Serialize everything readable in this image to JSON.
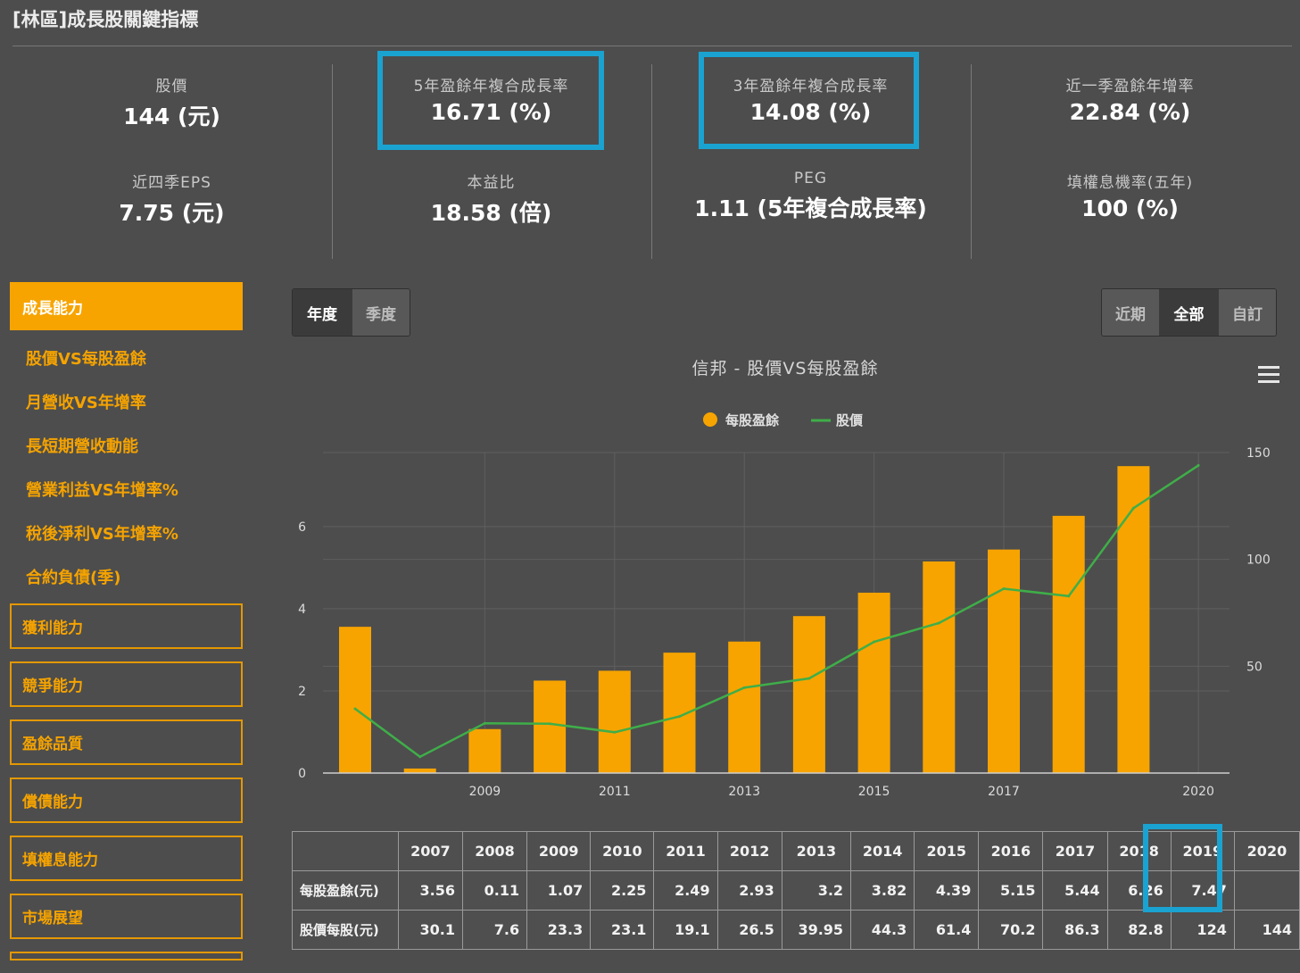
{
  "page_title": "[林區]成長股關鍵指標",
  "kpis": [
    {
      "label": "股價",
      "value": "144 (元)"
    },
    {
      "label": "近四季EPS",
      "value": "7.75 (元)"
    },
    {
      "label": "5年盈餘年複合成長率",
      "value": "16.71 (%)"
    },
    {
      "label": "本益比",
      "value": "18.58 (倍)"
    },
    {
      "label": "3年盈餘年複合成長率",
      "value": "14.08 (%)"
    },
    {
      "label": "PEG",
      "value": "1.11 (5年複合成長率)"
    },
    {
      "label": "近一季盈餘年增率",
      "value": "22.84 (%)"
    },
    {
      "label": "填權息機率(五年)",
      "value": "100 (%)"
    }
  ],
  "sidebar": {
    "active": "成長能力",
    "sub_items": [
      "股價VS每股盈餘",
      "月營收VS年增率",
      "長短期營收動能",
      "營業利益VS年增率%",
      "稅後淨利VS年增率%",
      "合約負債(季)"
    ],
    "sections": [
      "獲利能力",
      "競爭能力",
      "盈餘品質",
      "償債能力",
      "填權息能力",
      "市場展望"
    ]
  },
  "period_toggle": {
    "options": [
      "年度",
      "季度"
    ],
    "selected": "年度"
  },
  "range_toggle": {
    "options": [
      "近期",
      "全部",
      "自訂"
    ],
    "selected": "全部"
  },
  "chart_title": "信邦 - 股價VS每股盈餘",
  "colors": {
    "eps_bar": "#f7a400",
    "price_line": "#3fae49",
    "highlight": "#1aa3d1",
    "accent": "#f7a400"
  },
  "chart_data": {
    "type": "bar",
    "title": "信邦 - 股價VS每股盈餘",
    "categories": [
      "2007",
      "2008",
      "2009",
      "2010",
      "2011",
      "2012",
      "2013",
      "2014",
      "2015",
      "2016",
      "2017",
      "2018",
      "2019",
      "2020"
    ],
    "x_tick_labels": [
      "2009",
      "2011",
      "2013",
      "2015",
      "2017",
      "2020"
    ],
    "series": [
      {
        "name": "每股盈餘",
        "type": "bar",
        "axis": "left",
        "values": [
          3.56,
          0.11,
          1.07,
          2.25,
          2.49,
          2.93,
          3.2,
          3.82,
          4.39,
          5.15,
          5.44,
          6.26,
          7.47,
          null
        ]
      },
      {
        "name": "股價",
        "type": "line",
        "axis": "right",
        "values": [
          30.1,
          7.6,
          23.3,
          23.1,
          19.1,
          26.5,
          39.95,
          44.3,
          61.4,
          70.2,
          86.3,
          82.8,
          124,
          144
        ]
      }
    ],
    "y_left": {
      "range": [
        0,
        7.8
      ],
      "ticks": [
        0,
        2,
        4,
        6
      ]
    },
    "y_right": {
      "range": [
        0,
        150
      ],
      "ticks": [
        50,
        100,
        150
      ]
    },
    "grid": true,
    "legend_position": "top-center"
  },
  "table": {
    "years": [
      "2007",
      "2008",
      "2009",
      "2010",
      "2011",
      "2012",
      "2013",
      "2014",
      "2015",
      "2016",
      "2017",
      "2018",
      "2019",
      "2020"
    ],
    "rows": [
      {
        "label": "每股盈餘(元)",
        "values": [
          "3.56",
          "0.11",
          "1.07",
          "2.25",
          "2.49",
          "2.93",
          "3.2",
          "3.82",
          "4.39",
          "5.15",
          "5.44",
          "6.26",
          "7.47",
          ""
        ]
      },
      {
        "label": "股價每股(元)",
        "values": [
          "30.1",
          "7.6",
          "23.3",
          "23.1",
          "19.1",
          "26.5",
          "39.95",
          "44.3",
          "61.4",
          "70.2",
          "86.3",
          "82.8",
          "124",
          "144"
        ]
      }
    ]
  }
}
